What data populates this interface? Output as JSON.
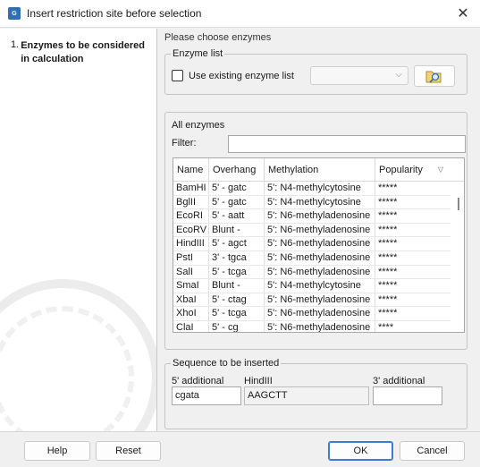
{
  "window": {
    "title": "Insert restriction site before selection",
    "app_icon_text": "G"
  },
  "wizard": {
    "steps": [
      {
        "number": "1.",
        "label": "Enzymes to be considered in calculation"
      }
    ]
  },
  "main": {
    "instruction": "Please choose enzymes"
  },
  "enzyme_list": {
    "legend": "Enzyme list",
    "use_existing_label": "Use existing enzyme list",
    "use_existing_checked": false,
    "selected_value": ""
  },
  "all_enzymes": {
    "legend": "All enzymes",
    "filter_label": "Filter:",
    "filter_value": "",
    "columns": [
      "Name",
      "Overhang",
      "Methylation",
      "Popularity"
    ],
    "rows": [
      [
        "BamHI",
        "5' - gatc",
        "5': N4-methylcytosine",
        "*****"
      ],
      [
        "BglII",
        "5' - gatc",
        "5': N4-methylcytosine",
        "*****"
      ],
      [
        "EcoRI",
        "5' - aatt",
        "5': N6-methyladenosine",
        "*****"
      ],
      [
        "EcoRV",
        "Blunt -",
        "5': N6-methyladenosine",
        "*****"
      ],
      [
        "HindIII",
        "5' - agct",
        "5': N6-methyladenosine",
        "*****"
      ],
      [
        "PstI",
        "3' - tgca",
        "5': N6-methyladenosine",
        "*****"
      ],
      [
        "SalI",
        "5' - tcga",
        "5': N6-methyladenosine",
        "*****"
      ],
      [
        "SmaI",
        "Blunt -",
        "5': N4-methylcytosine",
        "*****"
      ],
      [
        "XbaI",
        "5' - ctag",
        "5': N6-methyladenosine",
        "*****"
      ],
      [
        "XhoI",
        "5' - tcga",
        "5': N6-methyladenosine",
        "*****"
      ],
      [
        "ClaI",
        "5' - cg",
        "5': N6-methyladenosine",
        "****"
      ]
    ]
  },
  "sequence": {
    "legend": "Sequence to be inserted",
    "five_prime_label": "5' additional",
    "five_prime_value": "cgata",
    "enzyme_label": "HindIII",
    "site_value": "AAGCTT",
    "three_prime_label": "3' additional",
    "three_prime_value": ""
  },
  "buttons": {
    "help": "Help",
    "reset": "Reset",
    "ok": "OK",
    "cancel": "Cancel"
  },
  "colors": {
    "accent": "#3d7bd6",
    "app_icon": "#2e6fb5"
  }
}
